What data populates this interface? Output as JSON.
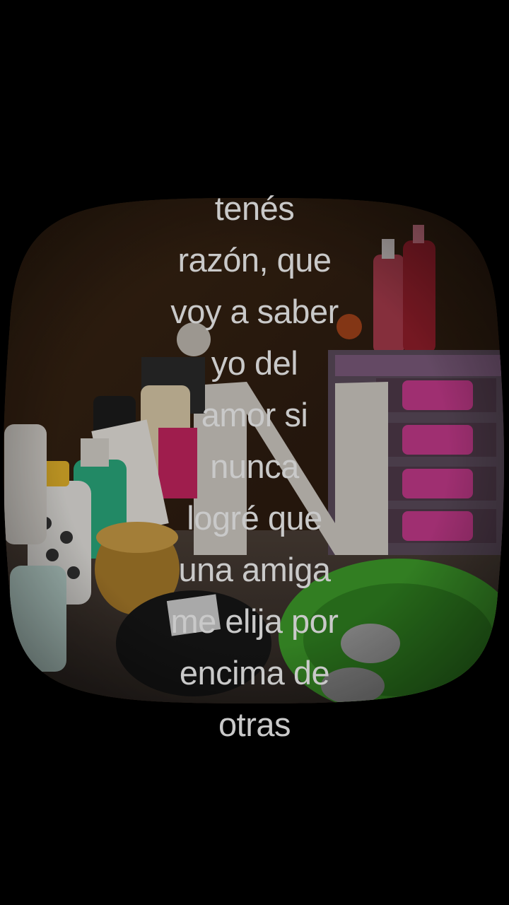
{
  "caption": {
    "lines": [
      "tenés",
      "razón, que",
      "voy a saber",
      "yo del",
      "amor si",
      "nunca",
      "logré que",
      "una amiga",
      "me elija por",
      "encima de",
      "otras"
    ]
  },
  "colors": {
    "background": "#000000",
    "caption_text": "#c9c9c9",
    "wall_wood": "#3a2413",
    "organizer_pink": "#c23a8a",
    "basin_green": "#3d9a2a"
  },
  "icons": {
    "photo": "cosmetics-shelf-photo"
  }
}
